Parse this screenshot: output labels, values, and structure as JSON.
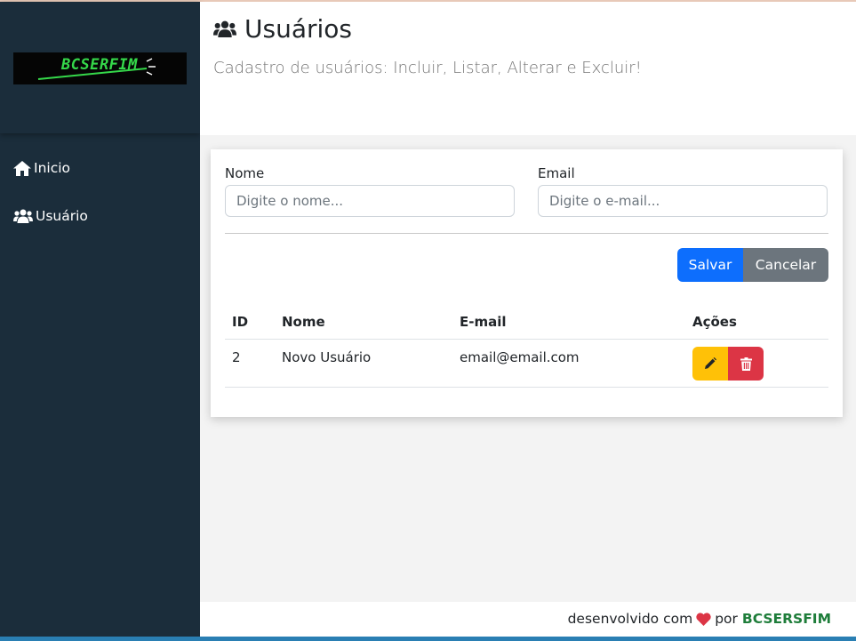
{
  "app": {
    "logo_text": "BCSERFIM"
  },
  "sidebar": {
    "items": [
      {
        "label": "Inicio",
        "icon": "home-icon"
      },
      {
        "label": "Usuário",
        "icon": "users-icon"
      }
    ]
  },
  "header": {
    "title": "Usuários",
    "subtitle": "Cadastro de usuários: Incluir, Listar, Alterar e Excluir!"
  },
  "form": {
    "name_label": "Nome",
    "name_placeholder": "Digite o nome...",
    "name_value": "",
    "email_label": "Email",
    "email_placeholder": "Digite o e-mail...",
    "email_value": "",
    "save_label": "Salvar",
    "cancel_label": "Cancelar"
  },
  "table": {
    "headers": [
      "ID",
      "Nome",
      "E-mail",
      "Ações"
    ],
    "rows": [
      {
        "id": "2",
        "nome": "Novo Usuário",
        "email": "email@email.com"
      }
    ]
  },
  "footer": {
    "prefix": "desenvolvido com",
    "middle": "por",
    "brand": "BCSERSFIM"
  },
  "colors": {
    "sidebar": "#1b2d3b",
    "primary": "#0d6efd",
    "secondary": "#6c757d",
    "warning": "#ffc107",
    "danger": "#dc3545",
    "brand_green": "#1e7d3a",
    "heart": "#dc3545"
  }
}
